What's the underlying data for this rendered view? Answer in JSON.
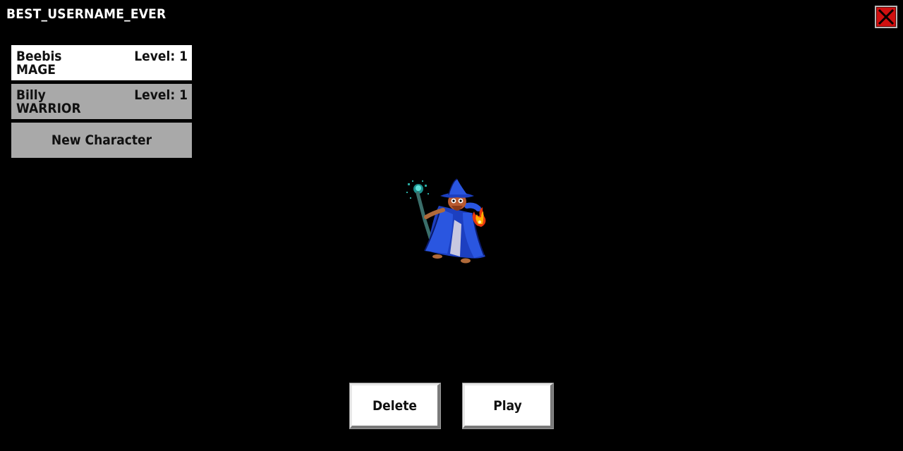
{
  "header": {
    "username": "BEST_USERNAME_EVER"
  },
  "characters": [
    {
      "name": "Beebis",
      "class": "MAGE",
      "level_text": "Level: 1",
      "selected": true
    },
    {
      "name": "Billy",
      "class": "WARRIOR",
      "level_text": "Level: 1",
      "selected": false
    }
  ],
  "new_character_label": "New Character",
  "actions": {
    "delete_label": "Delete",
    "play_label": "Play"
  },
  "icons": {
    "close": "close-icon",
    "character_preview": "mage-sprite"
  },
  "colors": {
    "background": "#000000",
    "selected_slot": "#ffffff",
    "unselected_slot": "#a9a9a9",
    "close_button": "#d01010"
  }
}
